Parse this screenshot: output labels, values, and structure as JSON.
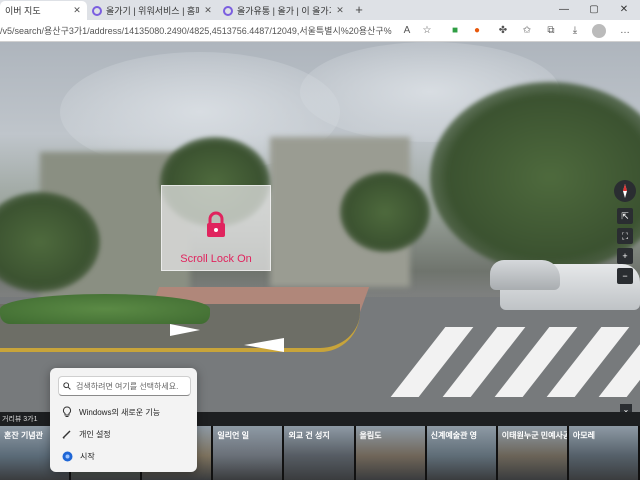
{
  "browser": {
    "tabs": [
      {
        "title": "이버 지도",
        "active": true
      },
      {
        "title": "올가기 | 위워서비스 | 홈페디",
        "active": false
      },
      {
        "title": "올가유통 | 올가 | 이 올가기",
        "active": false
      }
    ],
    "url": "/v5/search/용산구3가1/address/14135080.2490/4825,4513756.4487/12049,서울특별시%20용산구%20용산..."
  },
  "streetview": {
    "scroll_lock_label": "Scroll Lock On"
  },
  "strip": {
    "header_label": "거리뷰 3가1",
    "thumbnails": [
      {
        "title": "혼잔 기념관",
        "subtitle": "",
        "color": "#5b6b78"
      },
      {
        "title": "",
        "subtitle": "",
        "color": "#6e7f6a"
      },
      {
        "title": "",
        "subtitle": "",
        "color": "#7d725e"
      },
      {
        "title": "일리언 일",
        "subtitle": "",
        "color": "#6a7078"
      },
      {
        "title": "외교 건 성지",
        "subtitle": "",
        "color": "#565c63"
      },
      {
        "title": "올림도",
        "subtitle": "",
        "color": "#706659"
      },
      {
        "title": "신계예술관 영",
        "subtitle": "",
        "color": "#5f6d77"
      },
      {
        "title": "이태원누군 민예사공원",
        "subtitle": "",
        "color": "#6b6458"
      },
      {
        "title": "아모레",
        "subtitle": "",
        "color": "#556069"
      }
    ]
  },
  "popup": {
    "search_placeholder": "검색하려면 여기를 선택하세요.",
    "items": [
      {
        "label": "Windows의 새로운 기능",
        "icon": "lightbulb-icon"
      },
      {
        "label": "개인 설정",
        "icon": "pencil-icon"
      },
      {
        "label": "시작",
        "icon": "start-icon"
      }
    ]
  }
}
